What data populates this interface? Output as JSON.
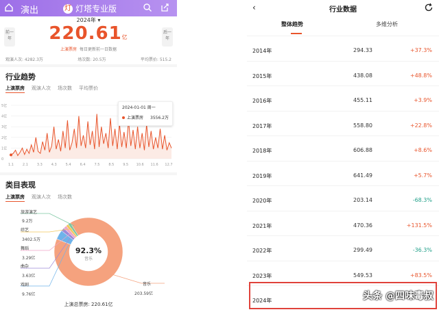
{
  "left": {
    "app_title": "演出",
    "brand": "灯塔专业版",
    "brand_logo": "灯",
    "year_selector": "2024年 ▾",
    "big_value": "220.61",
    "big_unit": "亿",
    "tag": "上演票房",
    "update_note": "每日更新前一日数据",
    "prev_label": "前一年",
    "next_label": "后一年",
    "stats": [
      "观演人次: 4282.3万",
      "场次数: 20.5万",
      "平均票价: 515.2"
    ],
    "trend_title": "行业趋势",
    "trend_tabs": [
      "上演票房",
      "观演人次",
      "场次数",
      "平均票价"
    ],
    "tooltip": {
      "date": "2024-01-01 周一",
      "series": "上演票房",
      "value": "3556.2万"
    },
    "category_title": "类目表现",
    "category_tabs": [
      "上演票房",
      "观演人次",
      "场次数"
    ],
    "categories": [
      {
        "name": "旅游演艺",
        "value": "9.2万"
      },
      {
        "name": "综艺",
        "value": "3402.5万"
      },
      {
        "name": "舞蹈",
        "value": "3.29亿"
      },
      {
        "name": "曲杂",
        "value": "3.63亿"
      },
      {
        "name": "戏剧",
        "value": "9.76亿"
      },
      {
        "name": "音乐",
        "value": "203.59亿"
      }
    ],
    "donut_pct": "92.3%",
    "donut_label": "音乐",
    "total": "上演总票房: 220.61亿"
  },
  "chart_data": {
    "type": "line",
    "title": "",
    "xlabel": "",
    "ylabel": "",
    "x_ticks": [
      "1.1",
      "2.1",
      "3.3",
      "4.3",
      "5.4",
      "6.4",
      "7.5",
      "8.5",
      "9.5",
      "10.6",
      "11.6",
      "12.7"
    ],
    "y_ticks": [
      "0",
      "1亿",
      "2亿",
      "3亿",
      "4亿",
      "5亿"
    ],
    "ylim": [
      0,
      5
    ],
    "y_unit": "亿",
    "series": [
      {
        "name": "上演票房",
        "values": [
          0.36,
          0.5,
          0.8,
          0.3,
          0.6,
          1.0,
          0.4,
          0.9,
          0.5,
          1.3,
          0.6,
          2.0,
          0.7,
          0.5,
          1.6,
          0.8,
          2.4,
          0.6,
          1.2,
          3.0,
          0.9,
          1.8,
          0.7,
          2.6,
          1.0,
          3.6,
          0.8,
          1.5,
          2.8,
          1.0,
          4.0,
          1.2,
          2.2,
          1.0,
          3.5,
          1.3,
          2.6,
          0.9,
          4.2,
          1.1,
          3.0,
          1.4,
          2.4,
          1.0,
          3.8,
          1.2,
          2.8,
          0.9,
          3.3,
          1.1,
          2.5,
          1.0,
          3.6,
          1.2,
          2.7,
          0.9,
          3.0,
          1.0,
          2.4,
          0.8,
          3.2,
          1.1,
          2.6,
          0.9,
          2.0,
          1.0,
          2.8,
          0.9,
          2.2,
          0.8,
          1.5,
          1.0
        ]
      }
    ],
    "colors": {
      "line": "#e8542b"
    }
  },
  "donut_data": {
    "type": "pie",
    "slices": [
      {
        "name": "音乐",
        "value": 203.59,
        "color": "#f5a27e"
      },
      {
        "name": "戏剧",
        "value": 9.76,
        "color": "#6fb3ea"
      },
      {
        "name": "曲杂",
        "value": 3.63,
        "color": "#9e8ad8"
      },
      {
        "name": "舞蹈",
        "value": 3.29,
        "color": "#f0a5c6"
      },
      {
        "name": "综艺",
        "value": 0.34,
        "color": "#f2c75b"
      },
      {
        "name": "旅游演艺",
        "value": 0.02,
        "color": "#7cc6a2"
      }
    ]
  },
  "right": {
    "title": "行业数据",
    "tabs": [
      "整体趋势",
      "多维分析"
    ],
    "rows": [
      {
        "year": "2014年",
        "value": "294.33",
        "pct": "+37.3%",
        "dir": "up"
      },
      {
        "year": "2015年",
        "value": "438.08",
        "pct": "+48.8%",
        "dir": "up"
      },
      {
        "year": "2016年",
        "value": "455.11",
        "pct": "+3.9%",
        "dir": "up"
      },
      {
        "year": "2017年",
        "value": "558.80",
        "pct": "+22.8%",
        "dir": "up"
      },
      {
        "year": "2018年",
        "value": "606.88",
        "pct": "+8.6%",
        "dir": "up"
      },
      {
        "year": "2019年",
        "value": "641.49",
        "pct": "+5.7%",
        "dir": "up"
      },
      {
        "year": "2020年",
        "value": "203.14",
        "pct": "-68.3%",
        "dir": "down"
      },
      {
        "year": "2021年",
        "value": "470.36",
        "pct": "+131.5%",
        "dir": "up"
      },
      {
        "year": "2022年",
        "value": "299.49",
        "pct": "-36.3%",
        "dir": "down"
      },
      {
        "year": "2023年",
        "value": "549.53",
        "pct": "+83.5%",
        "dir": "up"
      },
      {
        "year": "2024年",
        "value": "",
        "pct": "",
        "dir": "up"
      }
    ],
    "watermark": "头条 @四味毒叔"
  }
}
